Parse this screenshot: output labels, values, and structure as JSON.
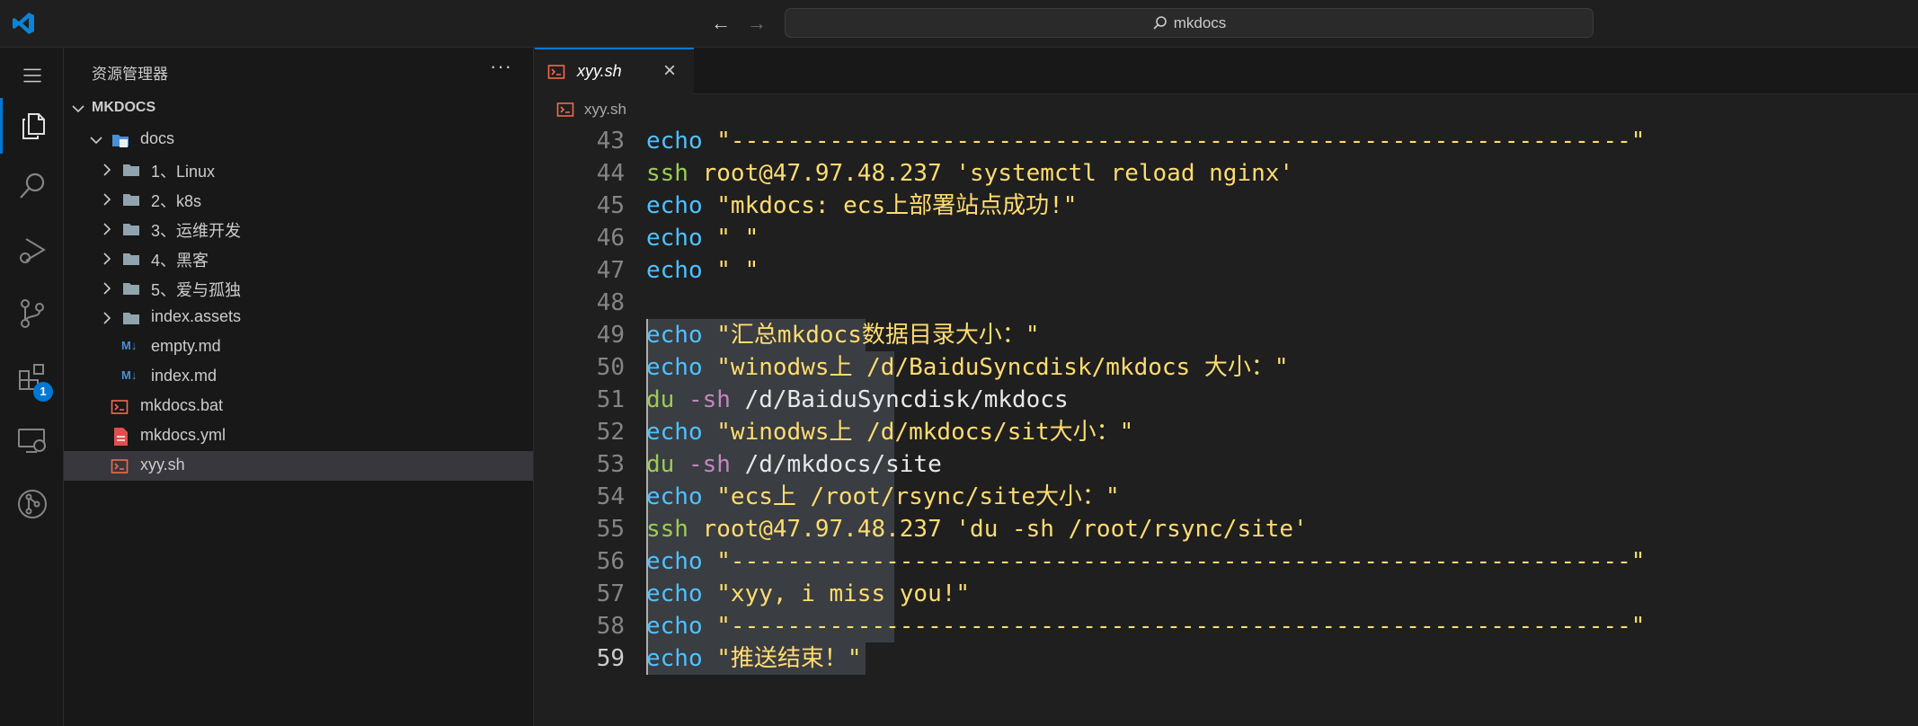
{
  "titlebar": {
    "search_text": "mkdocs"
  },
  "activitybar": {
    "items": [
      "explorer-icon",
      "search-icon",
      "run-debug-icon",
      "source-control-icon",
      "extensions-icon",
      "remote-explorer-icon",
      "git-graph-icon"
    ],
    "extensions_badge": "1",
    "accent": "#0078d4"
  },
  "sidebar": {
    "title": "资源管理器",
    "more": "···",
    "section": "MKDOCS",
    "tree": [
      {
        "label": "docs",
        "kind": "folder-open",
        "depth": 1
      },
      {
        "label": "1、Linux",
        "kind": "folder",
        "depth": 2
      },
      {
        "label": "2、k8s",
        "kind": "folder",
        "depth": 2
      },
      {
        "label": "3、运维开发",
        "kind": "folder",
        "depth": 2
      },
      {
        "label": "4、黑客",
        "kind": "folder",
        "depth": 2
      },
      {
        "label": "5、爱与孤独",
        "kind": "folder",
        "depth": 2
      },
      {
        "label": "index.assets",
        "kind": "folder",
        "depth": 2
      },
      {
        "label": "empty.md",
        "kind": "markdown",
        "depth": 2
      },
      {
        "label": "index.md",
        "kind": "markdown",
        "depth": 2
      },
      {
        "label": "mkdocs.bat",
        "kind": "shell",
        "depth": 1
      },
      {
        "label": "mkdocs.yml",
        "kind": "yaml",
        "depth": 1
      },
      {
        "label": "xyy.sh",
        "kind": "shell",
        "depth": 1,
        "selected": true
      }
    ]
  },
  "editor": {
    "tab_label": "xyy.sh",
    "breadcrumb": "xyy.sh",
    "lines": [
      {
        "n": "43",
        "code": [
          [
            "echo",
            "kw-echo"
          ],
          [
            " \"----------------------------------------------------------------\"",
            "str"
          ]
        ]
      },
      {
        "n": "44",
        "code": [
          [
            "ssh",
            "kw-green"
          ],
          [
            " root@47.97.48.237 'systemctl reload nginx'",
            "str"
          ]
        ]
      },
      {
        "n": "45",
        "code": [
          [
            "echo",
            "kw-echo"
          ],
          [
            " \"mkdocs: ecs上部署站点成功!\"",
            "str"
          ]
        ]
      },
      {
        "n": "46",
        "code": [
          [
            "echo",
            "kw-echo"
          ],
          [
            " \" \"",
            "str"
          ]
        ]
      },
      {
        "n": "47",
        "code": [
          [
            "echo",
            "kw-echo"
          ],
          [
            " \" \"",
            "str"
          ]
        ]
      },
      {
        "n": "48",
        "code": []
      },
      {
        "n": "49",
        "code": [
          [
            "echo",
            "kw-echo"
          ],
          [
            " \"汇总mkdocs数据目录大小：\"",
            "str"
          ]
        ]
      },
      {
        "n": "50",
        "code": [
          [
            "echo",
            "kw-echo"
          ],
          [
            " \"winodws上 /d/BaiduSyncdisk/mkdocs 大小：\"",
            "str"
          ]
        ]
      },
      {
        "n": "51",
        "code": [
          [
            "du",
            "kw-green"
          ],
          [
            " -sh",
            "flag"
          ],
          [
            " /d/BaiduSyncdisk/mkdocs",
            "plain"
          ]
        ]
      },
      {
        "n": "52",
        "code": [
          [
            "echo",
            "kw-echo"
          ],
          [
            " \"winodws上 /d/mkdocs/sit大小：\"",
            "str"
          ]
        ]
      },
      {
        "n": "53",
        "code": [
          [
            "du",
            "kw-green"
          ],
          [
            " -sh",
            "flag"
          ],
          [
            " /d/mkdocs/site",
            "plain"
          ]
        ]
      },
      {
        "n": "54",
        "code": [
          [
            "echo",
            "kw-echo"
          ],
          [
            " \"ecs上 /root/rsync/site大小：\"",
            "str"
          ]
        ]
      },
      {
        "n": "55",
        "code": [
          [
            "ssh",
            "kw-green"
          ],
          [
            " root@47.97.48.237 'du -sh /root/rsync/site'",
            "str"
          ]
        ]
      },
      {
        "n": "56",
        "code": [
          [
            "echo",
            "kw-echo"
          ],
          [
            " \"----------------------------------------------------------------\"",
            "str"
          ]
        ]
      },
      {
        "n": "57",
        "code": [
          [
            "echo",
            "kw-echo"
          ],
          [
            " \"xyy, i miss you!\"",
            "str"
          ]
        ]
      },
      {
        "n": "58",
        "code": [
          [
            "echo",
            "kw-echo"
          ],
          [
            " \"----------------------------------------------------------------\"",
            "str"
          ]
        ]
      },
      {
        "n": "59",
        "code": [
          [
            "echo",
            "kw-echo"
          ],
          [
            " \"推送结束！\"",
            "str"
          ]
        ]
      }
    ]
  }
}
